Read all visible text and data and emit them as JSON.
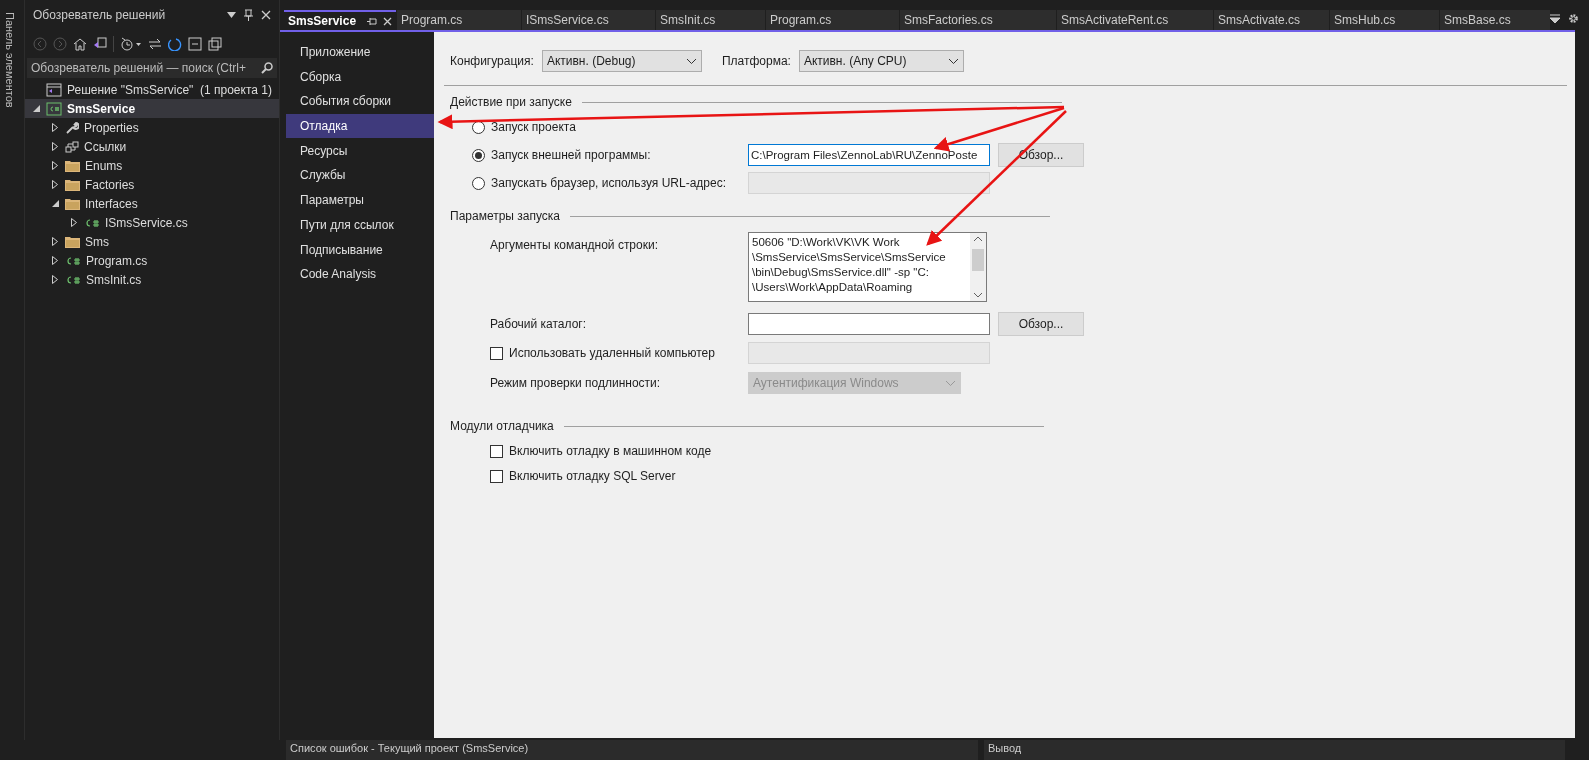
{
  "side_strip": {
    "label": "Панель элементов"
  },
  "solution_explorer": {
    "title": "Обозреватель решений",
    "search": {
      "placeholder": "Обозреватель решений — поиск (Ctrl+"
    },
    "tree": [
      {
        "kind": "solution",
        "label": "Решение \"SmsService\"  (1 проекта 1)",
        "selected": false,
        "children": [
          {
            "kind": "project",
            "label": "SmsService",
            "expanded": true,
            "selected": true,
            "children": [
              {
                "kind": "properties",
                "label": "Properties",
                "expanded": false,
                "selected": false
              },
              {
                "kind": "references",
                "label": "Ссылки",
                "expanded": false,
                "selected": false
              },
              {
                "kind": "folder",
                "label": "Enums",
                "expanded": false,
                "selected": false
              },
              {
                "kind": "folder",
                "label": "Factories",
                "expanded": false,
                "selected": false
              },
              {
                "kind": "folder",
                "label": "Interfaces",
                "expanded": true,
                "selected": false,
                "children": [
                  {
                    "kind": "csharp",
                    "label": "ISmsService.cs",
                    "expanded": false,
                    "selected": false
                  }
                ]
              },
              {
                "kind": "folder",
                "label": "Sms",
                "expanded": false,
                "selected": false
              },
              {
                "kind": "csharp",
                "label": "Program.cs",
                "expanded": false,
                "selected": false
              },
              {
                "kind": "csharp",
                "label": "SmsInit.cs",
                "expanded": false,
                "selected": false
              }
            ]
          }
        ]
      }
    ]
  },
  "tabs": [
    {
      "label": "SmsService",
      "selected": true
    },
    {
      "label": "Program.cs",
      "selected": false
    },
    {
      "label": "ISmsService.cs",
      "selected": false
    },
    {
      "label": "SmsInit.cs",
      "selected": false
    },
    {
      "label": "Program.cs",
      "selected": false
    },
    {
      "label": "SmsFactories.cs",
      "selected": false
    },
    {
      "label": "SmsActivateRent.cs",
      "selected": false
    },
    {
      "label": "SmsActivate.cs",
      "selected": false
    },
    {
      "label": "SmsHub.cs",
      "selected": false
    },
    {
      "label": "SmsBase.cs",
      "selected": false
    }
  ],
  "nav": [
    {
      "label": "Приложение",
      "selected": false
    },
    {
      "label": "Сборка",
      "selected": false
    },
    {
      "label": "События сборки",
      "selected": false
    },
    {
      "label": "Отладка",
      "selected": true
    },
    {
      "label": "Ресурсы",
      "selected": false
    },
    {
      "label": "Службы",
      "selected": false
    },
    {
      "label": "Параметры",
      "selected": false
    },
    {
      "label": "Пути для ссылок",
      "selected": false
    },
    {
      "label": "Подписывание",
      "selected": false
    },
    {
      "label": "Code Analysis",
      "selected": false
    }
  ],
  "config": {
    "configuration_label": "Конфигурация:",
    "configuration_value": "Активн. (Debug)",
    "platform_label": "Платформа:",
    "platform_value": "Активн. (Any CPU)"
  },
  "start_action": {
    "title": "Действие при запуске",
    "options": [
      {
        "label": "Запуск проекта",
        "selected": false
      },
      {
        "label": "Запуск внешней программы:",
        "selected": true,
        "value": "C:\\Program Files\\ZennoLab\\RU\\ZennoPoste",
        "disabled": false,
        "button": "Обзор..."
      },
      {
        "label": "Запускать браузер, используя URL-адрес:",
        "selected": false,
        "disabled": true
      }
    ]
  },
  "start_options": {
    "title": "Параметры запуска",
    "arguments_label": "Аргументы командной строки:",
    "arguments_lines": [
      "50606 \"D:\\Work\\VK\\VK Work",
      "\\SmsService\\SmsService\\SmsService",
      "\\bin\\Debug\\SmsService.dll\" -sp \"C:",
      "\\Users\\Work\\AppData\\Roaming"
    ],
    "working_dir_label": "Рабочий каталог:",
    "working_dir_button": "Обзор...",
    "remote_label": "Использовать удаленный компьютер",
    "remote_checked": false,
    "auth_label": "Режим проверки подлинности:",
    "auth_value": "Аутентификация Windows"
  },
  "debugger_modules": {
    "title": "Модули отладчика",
    "options": [
      {
        "label": "Включить отладку в машинном коде",
        "checked": false
      },
      {
        "label": "Включить отладку SQL Server",
        "checked": false
      }
    ]
  },
  "bottom_panels": [
    {
      "title": "Список ошибок - Текущий проект (SmsService)"
    },
    {
      "title": "Вывод"
    }
  ]
}
